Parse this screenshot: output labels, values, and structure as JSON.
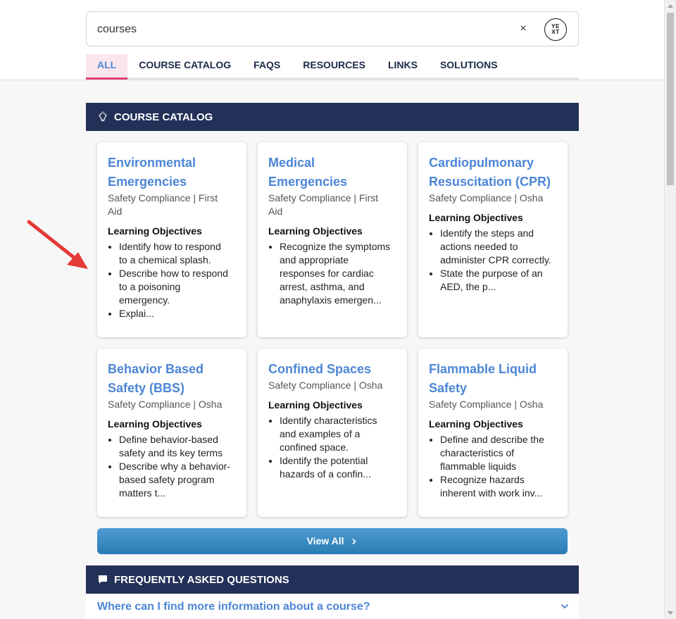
{
  "search": {
    "value": "courses",
    "clear_label": "×",
    "logo_text_top": "YE",
    "logo_text_bottom": "XT"
  },
  "tabs": [
    {
      "label": "ALL",
      "active": true
    },
    {
      "label": "COURSE CATALOG"
    },
    {
      "label": "FAQS"
    },
    {
      "label": "RESOURCES"
    },
    {
      "label": "LINKS"
    },
    {
      "label": "SOLUTIONS"
    }
  ],
  "course_section": {
    "icon": "lightbulb-icon",
    "title": "COURSE CATALOG",
    "objectives_label": "Learning Objectives",
    "cards": [
      {
        "title_lines": [
          "Environmental",
          "Emergencies"
        ],
        "subtitle_lines": [
          "Safety Compliance | First",
          "Aid"
        ],
        "objectives": [
          [
            "Identify how to respond",
            "to a chemical splash."
          ],
          [
            "Describe how to respond",
            "to a poisoning",
            "emergency."
          ],
          [
            "Explai..."
          ]
        ]
      },
      {
        "title_lines": [
          "Medical Emergencies"
        ],
        "subtitle_lines": [
          "Safety Compliance | First",
          "Aid"
        ],
        "objectives": [
          [
            "Recognize the symptoms",
            "and appropriate",
            "responses for cardiac",
            "arrest, asthma, and",
            "anaphylaxis emergen..."
          ]
        ]
      },
      {
        "title_lines": [
          "Cardiopulmonary",
          "Resuscitation (CPR)"
        ],
        "subtitle_lines": [
          "Safety Compliance | Osha"
        ],
        "objectives": [
          [
            "Identify the steps and",
            "actions needed to",
            "administer CPR correctly."
          ],
          [
            "State the purpose of an",
            "AED, the p..."
          ]
        ]
      },
      {
        "title_lines": [
          "Behavior Based",
          "Safety (BBS)"
        ],
        "subtitle_lines": [
          "Safety Compliance | Osha"
        ],
        "objectives": [
          [
            "Define behavior-based",
            "safety and its key terms"
          ],
          [
            "Describe why a behavior-",
            "based safety program",
            "matters t..."
          ]
        ]
      },
      {
        "title_lines": [
          "Confined Spaces"
        ],
        "subtitle_lines": [
          "Safety Compliance | Osha"
        ],
        "objectives": [
          [
            "Identify characteristics",
            "and examples of a",
            "confined space."
          ],
          [
            "Identify the potential",
            "hazards of a confin..."
          ]
        ]
      },
      {
        "title_lines": [
          "Flammable Liquid",
          "Safety"
        ],
        "subtitle_lines": [
          "Safety Compliance | Osha"
        ],
        "objectives": [
          [
            "Define and describe the",
            "characteristics of",
            "flammable liquids"
          ],
          [
            "Recognize hazards",
            "inherent with work inv..."
          ]
        ]
      }
    ],
    "view_all_label": "View All",
    "view_all_icon": "chevron-right-icon"
  },
  "faq_section": {
    "icon": "chat-bubble-icon",
    "title": "FREQUENTLY ASKED QUESTIONS",
    "questions": [
      "Where can I find more information about a course?"
    ],
    "expand_icon": "chevron-down-icon"
  },
  "colors": {
    "accent_blue": "#4c86d6",
    "header_navy": "#233158",
    "active_tab_underline": "#e4407a",
    "annotation_red": "#e53935"
  }
}
